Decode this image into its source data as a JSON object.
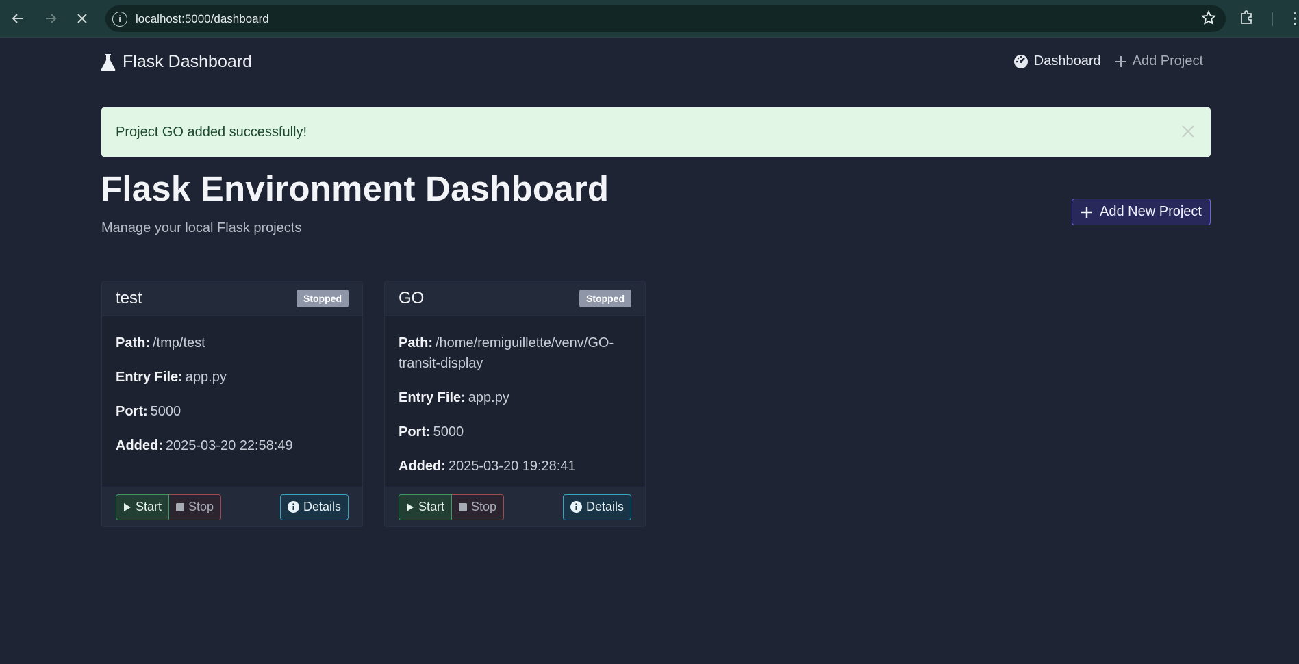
{
  "browser": {
    "url": "localhost:5000/dashboard"
  },
  "navbar": {
    "brand": "Flask Dashboard",
    "links": [
      {
        "label": "Dashboard",
        "icon": "tachometer-icon"
      },
      {
        "label": "Add Project",
        "icon": "plus-icon"
      }
    ]
  },
  "alert": {
    "message": "Project GO added successfully!"
  },
  "header": {
    "title": "Flask Environment Dashboard",
    "subtitle": "Manage your local Flask projects",
    "add_button": "Add New Project"
  },
  "projects": [
    {
      "name": "test",
      "status": "Stopped",
      "path_label": "Path:",
      "path": "/tmp/test",
      "entry_label": "Entry File:",
      "entry_file": "app.py",
      "port_label": "Port:",
      "port": "5000",
      "added_label": "Added:",
      "added": "2025-03-20 22:58:49",
      "start_label": "Start",
      "stop_label": "Stop",
      "details_label": "Details"
    },
    {
      "name": "GO",
      "status": "Stopped",
      "path_label": "Path:",
      "path": "/home/remiguillette/venv/GO-transit-display",
      "entry_label": "Entry File:",
      "entry_file": "app.py",
      "port_label": "Port:",
      "port": "5000",
      "added_label": "Added:",
      "added": "2025-03-20 19:28:41",
      "start_label": "Start",
      "stop_label": "Stop",
      "details_label": "Details"
    }
  ],
  "colors": {
    "background": "#1e2433",
    "alert_bg": "#e2f6e6",
    "primary": "#6b63e6",
    "success": "#3f9a62",
    "danger": "#a24a52",
    "info": "#36a3c0",
    "badge": "#8e96a8"
  }
}
